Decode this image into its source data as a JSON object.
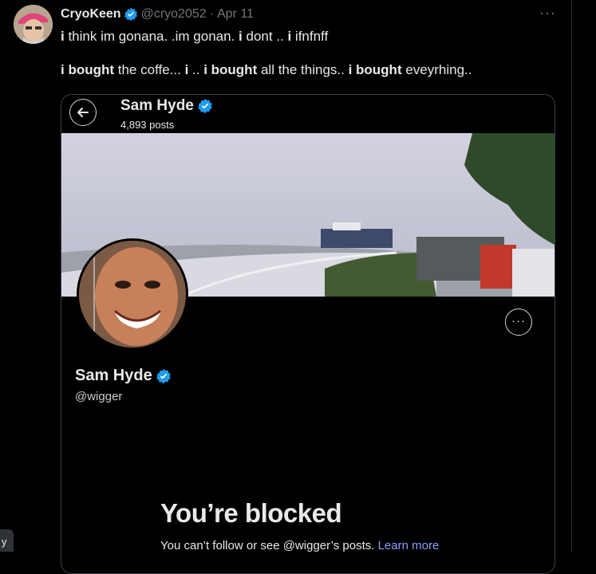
{
  "tweet": {
    "display_name": "CryoKeen",
    "handle": "@cryo2052",
    "separator": "·",
    "date": "Apr 11",
    "more_icon": "···",
    "line1": [
      {
        "t": "i",
        "b": true
      },
      {
        "t": " think im gonana. .im gonan. ",
        "b": false
      },
      {
        "t": "i",
        "b": true
      },
      {
        "t": " dont .. ",
        "b": false
      },
      {
        "t": "i",
        "b": true
      },
      {
        "t": " ifnfnff",
        "b": false
      }
    ],
    "line2": [
      {
        "t": "i bought",
        "b": true
      },
      {
        "t": " the coffe... ",
        "b": false
      },
      {
        "t": "i",
        "b": true
      },
      {
        "t": " .. ",
        "b": false
      },
      {
        "t": "i bought",
        "b": true
      },
      {
        "t": " all the things.. ",
        "b": false
      },
      {
        "t": "i bought",
        "b": true
      },
      {
        "t": " eveyrhing..",
        "b": false
      }
    ]
  },
  "embedded": {
    "name": "Sam Hyde",
    "posts": "4,893 posts",
    "profile_name": "Sam Hyde",
    "profile_handle": "@wigger",
    "more_icon": "···",
    "blocked_title": "You’re blocked",
    "blocked_text": "You can’t follow or see @wigger’s posts. ",
    "learn_more": "Learn more"
  },
  "left_stub": "y",
  "colors": {
    "verified": "#1d9bf0",
    "link": "#8c9bff",
    "muted": "#71767b",
    "background": "#000000"
  },
  "icons": [
    "verified-badge-icon",
    "back-arrow-icon",
    "more-options-icon"
  ]
}
